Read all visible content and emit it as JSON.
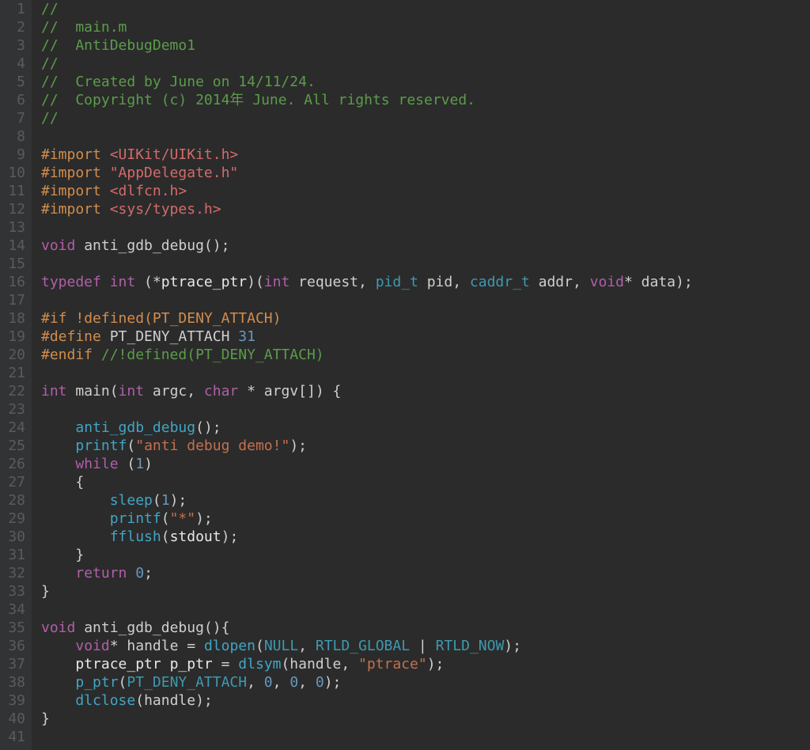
{
  "line_count": 41,
  "code": {
    "l1": {
      "comment": "//"
    },
    "l2": {
      "comment": "//  main.m"
    },
    "l3": {
      "comment": "//  AntiDebugDemo1"
    },
    "l4": {
      "comment": "//"
    },
    "l5": {
      "comment": "//  Created by June on 14/11/24."
    },
    "l6": {
      "comment": "//  Copyright (c) 2014年 June. All rights reserved."
    },
    "l7": {
      "comment": "//"
    },
    "l9": {
      "kw": "#import ",
      "arg": "<UIKit/UIKit.h>"
    },
    "l10": {
      "kw": "#import ",
      "arg": "\"AppDelegate.h\""
    },
    "l11": {
      "kw": "#import ",
      "arg": "<dlfcn.h>"
    },
    "l12": {
      "kw": "#import ",
      "arg": "<sys/types.h>"
    },
    "l14": {
      "t1": "void",
      "name": " anti_gdb_debug",
      "rest": "();"
    },
    "l16": {
      "tdef": "typedef ",
      "t1": "int",
      "op": " (*",
      "name": "ptrace_ptr",
      "cl": ")(",
      "t2": "int",
      "p2": " request, ",
      "t3": "pid_t",
      "p3": " pid, ",
      "t4": "caddr_t",
      "p4": " addr, ",
      "t5": "void",
      "p5": "* data);"
    },
    "l18": {
      "if": "#if ",
      "fn": "!defined",
      "rest": "(PT_DENY_ATTACH)"
    },
    "l19": {
      "def": "#define ",
      "name": "PT_DENY_ATTACH ",
      "val": "31"
    },
    "l20": {
      "end": "#endif ",
      "cm": "//!defined(PT_DENY_ATTACH)"
    },
    "l22": {
      "t1": "int",
      "name": " main",
      "op": "(",
      "t2": "int",
      "p2": " argc, ",
      "t3": "char",
      "p3": " * argv[]) {"
    },
    "l24": {
      "ind": "    ",
      "fn": "anti_gdb_debug",
      "r": "();"
    },
    "l25": {
      "ind": "    ",
      "fn": "printf",
      "o": "(",
      "s": "\"anti debug demo!\"",
      "c": ");"
    },
    "l26": {
      "ind": "    ",
      "kw": "while",
      "r": " (",
      "n": "1",
      "c": ")"
    },
    "l27": {
      "ind": "    ",
      "r": "{"
    },
    "l28": {
      "ind": "        ",
      "fn": "sleep",
      "o": "(",
      "n": "1",
      "c": ");"
    },
    "l29": {
      "ind": "        ",
      "fn": "printf",
      "o": "(",
      "s": "\"*\"",
      "c": ");"
    },
    "l30": {
      "ind": "        ",
      "fn": "fflush",
      "o": "(",
      "id": "stdout",
      "c": ");"
    },
    "l31": {
      "ind": "    ",
      "r": "}"
    },
    "l32": {
      "ind": "    ",
      "kw": "return ",
      "n": "0",
      "c": ";"
    },
    "l33": {
      "r": "}"
    },
    "l35": {
      "t1": "void",
      "name": " anti_gdb_debug",
      "r": "(){"
    },
    "l36": {
      "ind": "    ",
      "t1": "void",
      "p": "* handle = ",
      "fn": "dlopen",
      "o": "(",
      "c1": "NULL",
      "cm": ", ",
      "c2": "RTLD_GLOBAL",
      "pipe": " | ",
      "c3": "RTLD_NOW",
      "cl": ");"
    },
    "l37": {
      "ind": "    ",
      "id": "ptrace_ptr p_ptr",
      "eq": " = ",
      "fn": "dlsym",
      "o": "(",
      "arg": "handle, ",
      "s": "\"ptrace\"",
      "cl": ");"
    },
    "l38": {
      "ind": "    ",
      "fn": "p_ptr",
      "o": "(",
      "c1": "PT_DENY_ATTACH",
      "cm": ", ",
      "n1": "0",
      "cm2": ", ",
      "n2": "0",
      "cm3": ", ",
      "n3": "0",
      "cl": ");"
    },
    "l39": {
      "ind": "    ",
      "fn": "dlclose",
      "o": "(",
      "arg": "handle",
      "cl": ");"
    },
    "l40": {
      "r": "}"
    }
  }
}
